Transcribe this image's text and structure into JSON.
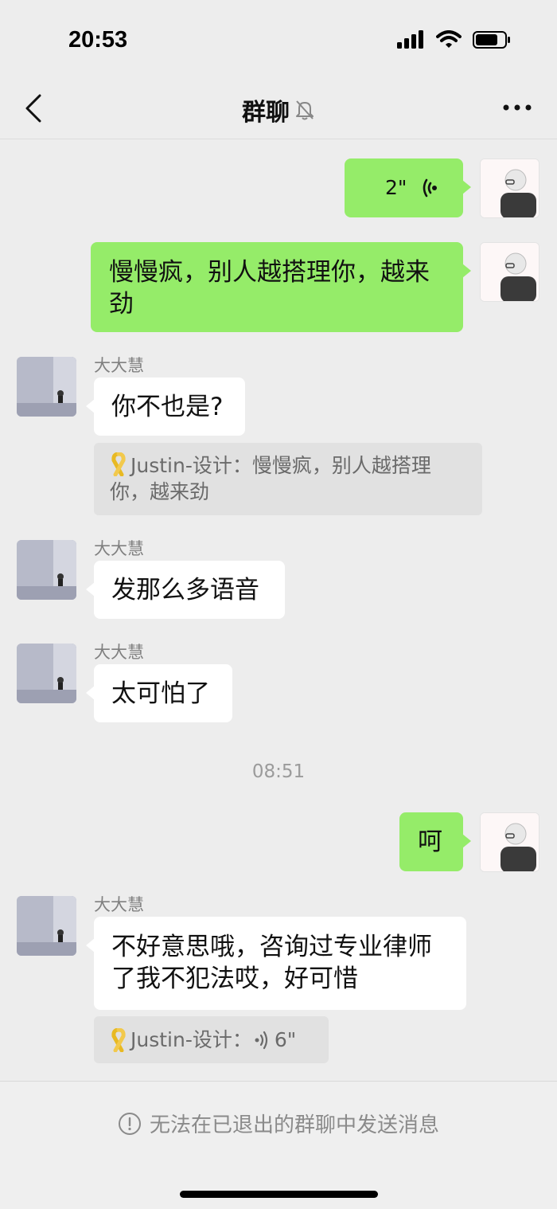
{
  "status_bar": {
    "time": "20:53"
  },
  "nav": {
    "title": "群聊",
    "back_icon": "chevron-left-icon",
    "mute_icon": "bell-off-icon",
    "more_icon": "more-icon"
  },
  "messages": [
    {
      "side": "self",
      "type": "voice",
      "duration": "2\""
    },
    {
      "side": "self",
      "type": "text",
      "text": "慢慢疯，别人越搭理你，越来劲"
    },
    {
      "side": "other",
      "sender": "大大慧",
      "text": "你不也是?",
      "quote": "Justin-设计：慢慢疯，别人越搭理你，越来劲"
    },
    {
      "side": "other",
      "sender": "大大慧",
      "text": "发那么多语音"
    },
    {
      "side": "other",
      "sender": "大大慧",
      "text": "太可怕了"
    },
    {
      "type": "time",
      "text": "08:51"
    },
    {
      "side": "self",
      "type": "text",
      "text": "呵"
    },
    {
      "side": "other",
      "sender": "大大慧",
      "text": "不好意思哦，咨询过专业律师了我不犯法哎，好可惜",
      "quote_prefix": "Justin-设计：",
      "quote_voice": "6\""
    }
  ],
  "footer": {
    "notice": "无法在已退出的群聊中发送消息",
    "icon": "info-circle-icon"
  },
  "colors": {
    "background": "#ededed",
    "self_bubble": "#95ec69",
    "other_bubble": "#ffffff",
    "quote_bg": "#e1e1e1"
  }
}
